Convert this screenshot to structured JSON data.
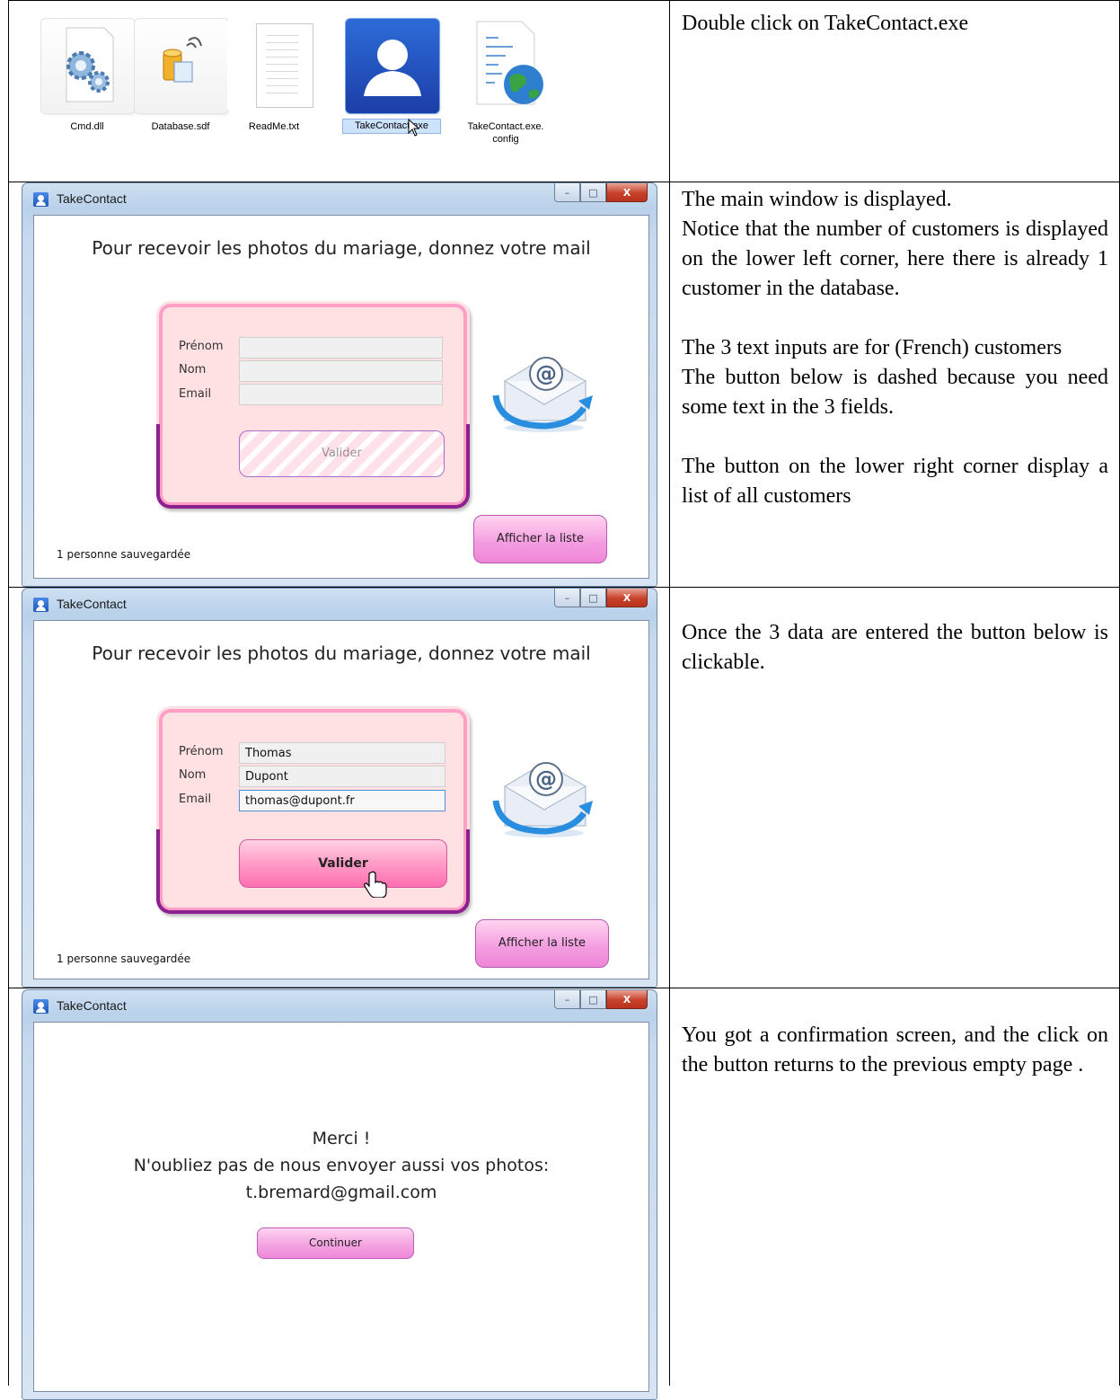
{
  "explorer": {
    "files": [
      {
        "name": "Cmd.dll",
        "icon": "gears-icon"
      },
      {
        "name": "Database.sdf",
        "icon": "database-icon"
      },
      {
        "name": "ReadMe.txt",
        "icon": "text-file-icon"
      },
      {
        "name": "TakeContact.exe",
        "icon": "contact-app-icon",
        "selected": true
      },
      {
        "name_line1": "TakeContact.exe.",
        "name_line2": "config",
        "icon": "config-globe-icon"
      }
    ]
  },
  "descriptions": {
    "row1": [
      "Double click on TakeContact.exe"
    ],
    "row2": {
      "p1": "The main window is displayed.",
      "p2": "Notice that the number of customers is displayed on the lower left corner, here there is already 1 customer in the database.",
      "p3": "The 3 text inputs are for (French) customers",
      "p4": "The button below is dashed because you need some text in the 3 fields.",
      "p5": "The button on the lower right corner display a list of all customers"
    },
    "row3": "Once the 3 data are entered the button below is clickable.",
    "row4": "You got a confirmation screen, and the click on the button returns to the previous empty page ."
  },
  "window": {
    "title": "TakeContact",
    "controls": {
      "minimize": "–",
      "maximize": "□",
      "close": "X"
    }
  },
  "form": {
    "heading": "Pour recevoir les photos du mariage, donnez votre mail",
    "labels": {
      "first_name": "Prénom",
      "last_name": "Nom",
      "email": "Email"
    },
    "submit_label": "Valider",
    "list_button": "Afficher la liste",
    "count": "1 personne sauvegardée"
  },
  "filled": {
    "first_name": "Thomas",
    "last_name": "Dupont",
    "email": "thomas@dupont.fr"
  },
  "confirm": {
    "line1": "Merci !",
    "line2": "N'oubliez pas de nous envoyer aussi vos photos:",
    "line3": "t.bremard@gmail.com",
    "button": "Continuer"
  },
  "colors": {
    "card_bg": "#ffe1e4",
    "card_border": "#8d1f8e",
    "button_pink": "#ff6fb0",
    "list_button": "#ee86d8"
  }
}
